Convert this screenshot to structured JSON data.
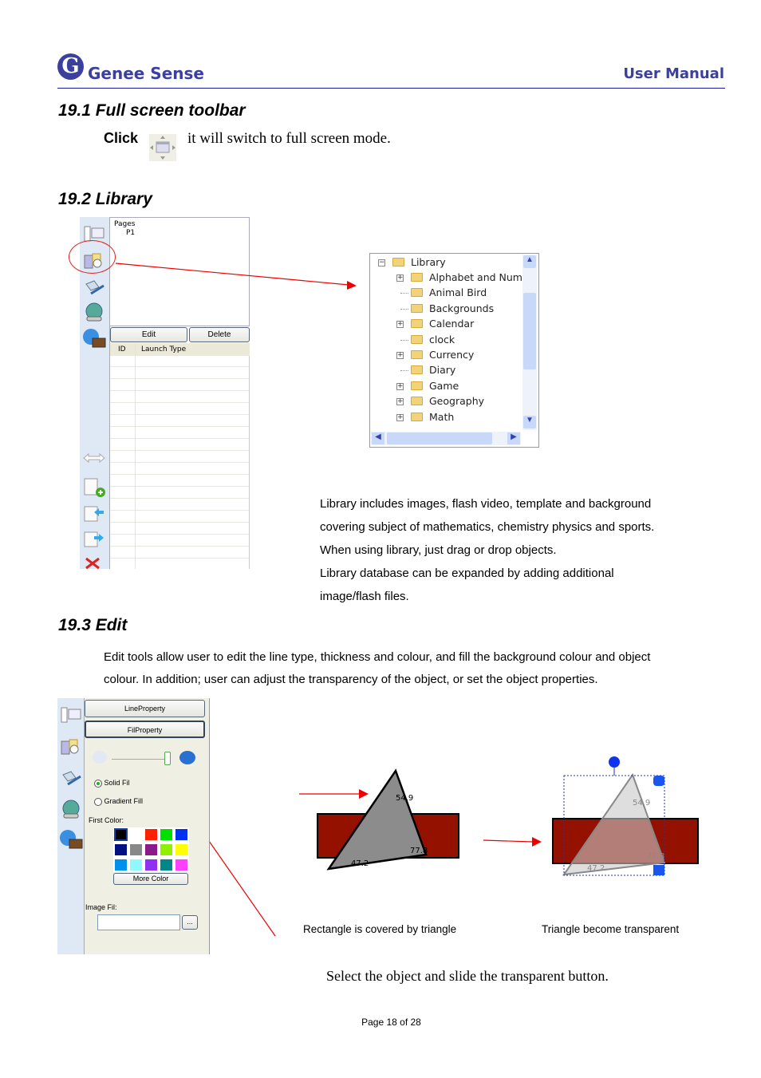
{
  "header": {
    "brand": "Genee Sense",
    "logo_letter": "G",
    "right_title": "User Manual"
  },
  "s191": {
    "title": "19.1  Full screen toolbar",
    "click": "Click",
    "text": "it will switch to full screen mode.",
    "icon": "fullscreen-icon"
  },
  "s192": {
    "title": "19.2  Library",
    "panel": {
      "pages_label": "Pages",
      "page_item": "P1",
      "edit_btn": "Edit",
      "delete_btn": "Delete",
      "col_id": "ID",
      "col_launch": "Launch Type"
    },
    "tree": {
      "root": "Library",
      "items": [
        {
          "label": "Alphabet and Numbe",
          "expandable": true
        },
        {
          "label": "Animal Bird",
          "expandable": false
        },
        {
          "label": "Backgrounds",
          "expandable": false
        },
        {
          "label": "Calendar",
          "expandable": true
        },
        {
          "label": "clock",
          "expandable": false
        },
        {
          "label": "Currency",
          "expandable": true
        },
        {
          "label": "Diary",
          "expandable": false
        },
        {
          "label": "Game",
          "expandable": true
        },
        {
          "label": "Geography",
          "expandable": true
        },
        {
          "label": "Math",
          "expandable": true
        }
      ]
    },
    "lines": [
      "Library includes images, flash video, template and background",
      "covering subject of mathematics, chemistry physics and sports.",
      "When using library, just drag or drop objects.",
      "Library database can be expanded by adding additional",
      "image/flash files."
    ]
  },
  "s193": {
    "title": "19.3   Edit",
    "lines": [
      "Edit tools allow user to edit the line type, thickness and colour, and fill the background colour and object",
      "colour.  In addition; user can adjust the transparency of the object, or set the object properties."
    ],
    "panel": {
      "line_btn": "LineProperty",
      "fill_btn": "FilProperty",
      "solid": "Solid Fil",
      "gradient": "Gradient Fill",
      "first_color": "First Color:",
      "more_color": "More Color",
      "image_fill": "Image Fil:",
      "browse": "...",
      "transparency": 1.0,
      "swatches": [
        "#000000",
        "#ffffff",
        "#ff2000",
        "#00e000",
        "#0030f0",
        "#001080",
        "#888888",
        "#8a1a8a",
        "#90f000",
        "#ffff00",
        "#0090f0",
        "#90f8ff",
        "#9030f0",
        "#008888",
        "#ff40ff"
      ]
    },
    "angles": [
      "54.9",
      "77.8",
      "47.2"
    ],
    "caption_left": "Rectangle is covered by triangle",
    "caption_right": "Triangle become transparent",
    "instruction": "Select the object and slide the transparent button.",
    "colors": {
      "rect": "#941100",
      "triangle": "#8c8c8c"
    }
  },
  "footer": {
    "page": "Page 18 of 28"
  }
}
